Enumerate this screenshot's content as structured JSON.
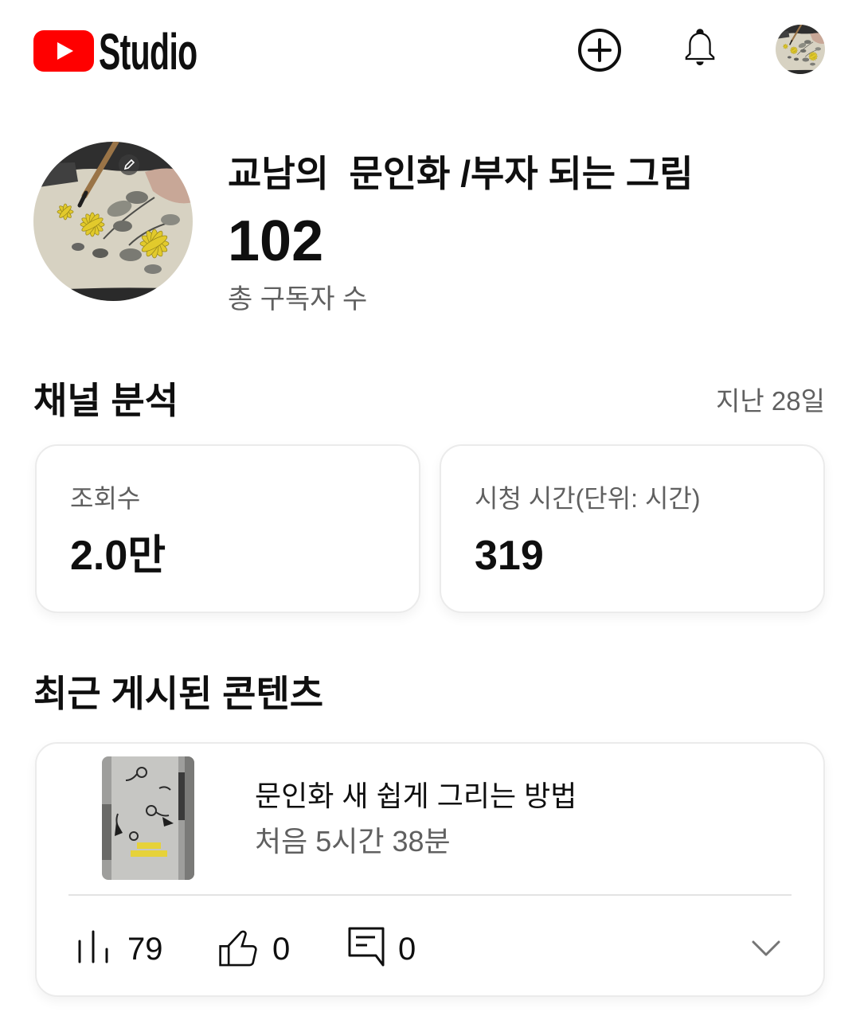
{
  "header": {
    "logo_text": "Studio",
    "icons": {
      "logo": "youtube-play-icon",
      "create": "plus-circle-icon",
      "notifications": "bell-icon"
    }
  },
  "channel": {
    "name": "교남의  문인화 /부자 되는 그림",
    "subscribers": "102",
    "subscribers_label": "총 구독자 수"
  },
  "analytics": {
    "title": "채널 분석",
    "period": "지난 28일",
    "cards": [
      {
        "label": "조회수",
        "value": "2.0만"
      },
      {
        "label": "시청 시간(단위: 시간)",
        "value": "319"
      }
    ]
  },
  "recent_content": {
    "title": "최근 게시된 콘텐츠",
    "items": [
      {
        "title": "문인화 새 쉽게 그리는 방법",
        "published": "처음 5시간 38분",
        "views": "79",
        "likes": "0",
        "comments": "0",
        "icons": [
          "bar-chart-icon",
          "thumbs-up-icon",
          "comment-icon",
          "chevron-down-icon"
        ]
      }
    ]
  },
  "colors": {
    "brand_red": "#ff0000",
    "text_primary": "#0f0f0f",
    "text_secondary": "#606060",
    "card_border": "#ebebeb"
  }
}
